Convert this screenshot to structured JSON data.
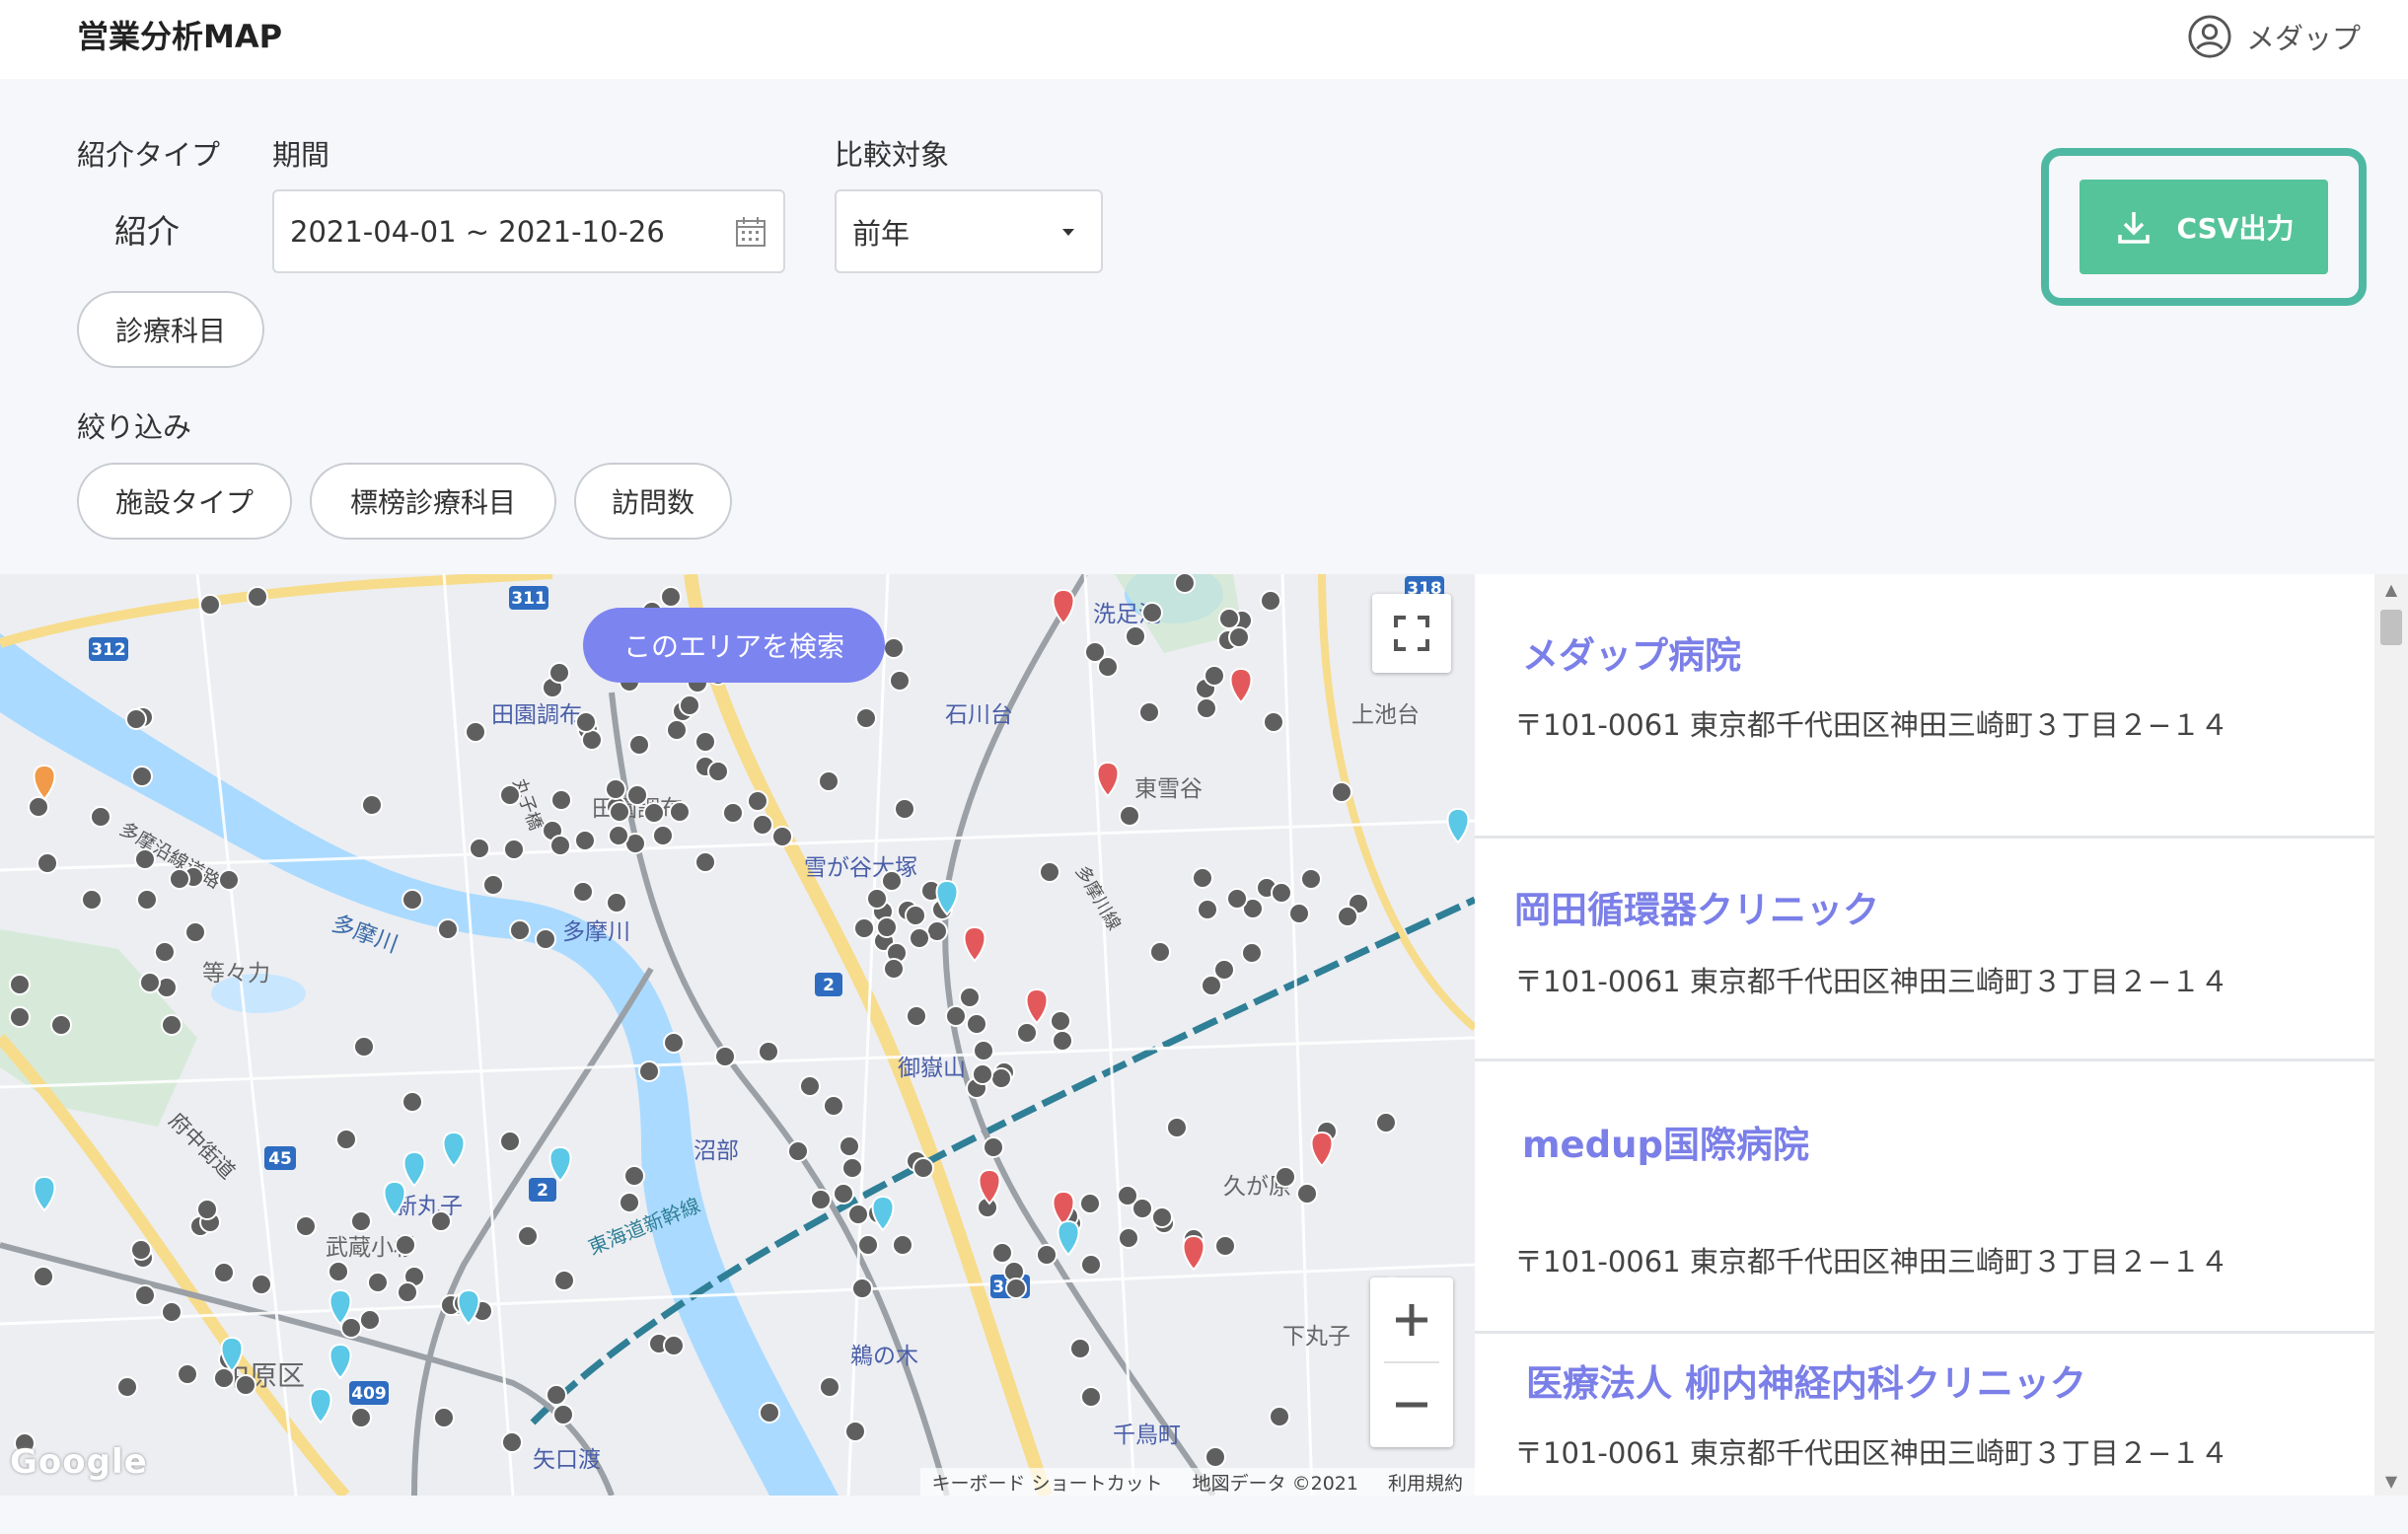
{
  "header": {
    "title": "営業分析MAP",
    "user_name": "メダップ"
  },
  "filters": {
    "referral_type_label": "紹介タイプ",
    "referral_type_value": "紹介",
    "period_label": "期間",
    "period_value": "2021-04-01 ~ 2021-10-26",
    "compare_label": "比較対象",
    "compare_value": "前年",
    "department_button": "診療科目",
    "narrow_label": "絞り込み",
    "narrow_buttons": [
      "施設タイプ",
      "標榜診療科目",
      "訪問数"
    ],
    "csv_button": "CSV出力"
  },
  "map": {
    "search_area_button": "このエリアを検索",
    "logo": "Google",
    "footer": [
      "キーボード ショートカット",
      "地図データ ©2021",
      "利用規約"
    ],
    "place_labels": [
      "洗足池",
      "田園調布",
      "石川台",
      "上池台",
      "東雪谷",
      "田園調布",
      "雪が谷大塚",
      "多摩川",
      "等々力",
      "御嶽山",
      "沼部",
      "東海道新幹線",
      "久が原",
      "新丸子",
      "武蔵小杉",
      "中原区",
      "鵜の木",
      "千鳥町",
      "下丸子",
      "矢口渡",
      "府中街道",
      "多摩沿線道路",
      "多摩川",
      "丸子橋",
      "多摩川線"
    ],
    "road_numbers": [
      "311",
      "312",
      "318",
      "2",
      "45",
      "2",
      "311",
      "409"
    ],
    "colors": {
      "marker_gray": "#5f5f5f",
      "marker_red": "#e3595b",
      "marker_cyan": "#5ac8e6",
      "marker_orange": "#f09a4a",
      "water": "#aadaff",
      "highway": "#f7dc8c",
      "rail": "#2f7f96"
    }
  },
  "facilities": [
    {
      "name": "メダップ病院",
      "address": "〒101-0061 東京都千代田区神田三崎町３丁目２−１４"
    },
    {
      "name": "岡田循環器クリニック",
      "address": "〒101-0061 東京都千代田区神田三崎町３丁目２−１４"
    },
    {
      "name": "medup国際病院",
      "address": "〒101-0061 東京都千代田区神田三崎町３丁目２−１４"
    },
    {
      "name": "医療法人 柳内神経内科クリニック",
      "address": "〒101-0061 東京都千代田区神田三崎町３丁目２−１４"
    }
  ],
  "theme": {
    "accent": "#7c84f0",
    "csv_green": "#56c49a",
    "highlight_outline": "#4fb8a3",
    "link_purple": "#7b7fe8"
  }
}
